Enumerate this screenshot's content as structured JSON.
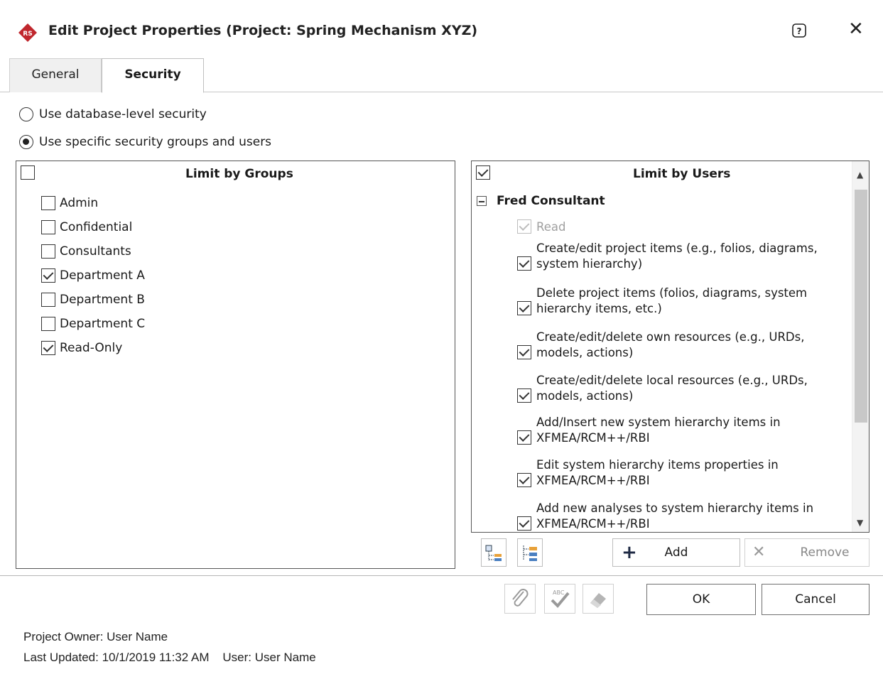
{
  "window": {
    "title": "Edit Project Properties (Project: Spring Mechanism XYZ)",
    "help_label": "?",
    "close_label": "✕"
  },
  "tabs": [
    {
      "label": "General",
      "active": false
    },
    {
      "label": "Security",
      "active": true
    }
  ],
  "security_mode": {
    "options": [
      {
        "label": "Use database-level security",
        "selected": false
      },
      {
        "label": "Use specific security groups and users",
        "selected": true
      }
    ]
  },
  "groups_panel": {
    "title": "Limit by Groups",
    "header_checked": false,
    "items": [
      {
        "label": "Admin",
        "checked": false
      },
      {
        "label": "Confidential",
        "checked": false
      },
      {
        "label": "Consultants",
        "checked": false
      },
      {
        "label": "Department A",
        "checked": true
      },
      {
        "label": "Department B",
        "checked": false
      },
      {
        "label": "Department C",
        "checked": false
      },
      {
        "label": "Read-Only",
        "checked": true
      }
    ]
  },
  "users_panel": {
    "title": "Limit by Users",
    "header_checked": true,
    "user": "Fred Consultant",
    "permissions": [
      {
        "label": "Read",
        "checked": true,
        "disabled": true
      },
      {
        "label": "Create/edit project items (e.g., folios, diagrams, system hierarchy)",
        "checked": true,
        "disabled": false
      },
      {
        "label": "Delete project items (folios, diagrams, system hierarchy items, etc.)",
        "checked": true,
        "disabled": false
      },
      {
        "label": "Create/edit/delete own resources (e.g., URDs, models, actions)",
        "checked": true,
        "disabled": false
      },
      {
        "label": "Create/edit/delete local resources (e.g., URDs, models, actions)",
        "checked": true,
        "disabled": false
      },
      {
        "label": "Add/Insert new system hierarchy items in XFMEA/RCM++/RBI",
        "checked": true,
        "disabled": false
      },
      {
        "label": "Edit system hierarchy items properties in XFMEA/RCM++/RBI",
        "checked": true,
        "disabled": false
      },
      {
        "label": "Add new analyses to system hierarchy items in XFMEA/RCM++/RBI",
        "checked": true,
        "disabled": false
      }
    ],
    "add_label": "Add",
    "remove_label": "Remove"
  },
  "footer": {
    "ok_label": "OK",
    "cancel_label": "Cancel",
    "owner": "Project Owner: User Name",
    "updated": "Last Updated: 10/1/2019 11:32 AM    User: User Name"
  },
  "colors": {
    "app_icon": "#c0272d",
    "panel_border": "#555555",
    "disabled_text": "#a0a0a0"
  }
}
